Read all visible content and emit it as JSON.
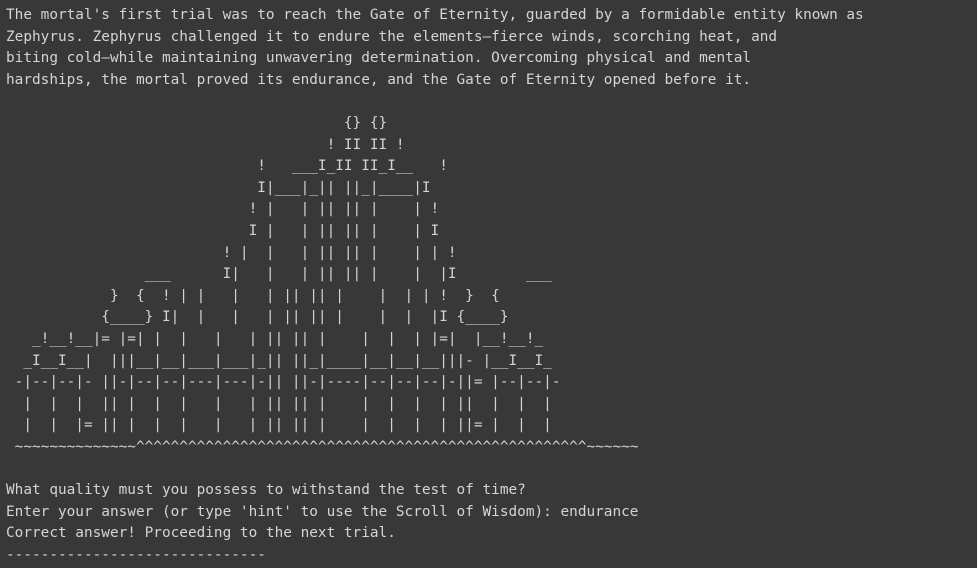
{
  "story": {
    "lines": [
      "The mortal's first trial was to reach the Gate of Eternity, guarded by a formidable entity known as",
      "Zephyrus. Zephyrus challenged it to endure the elements—fierce winds, scorching heat, and",
      "biting cold—while maintaining unwavering determination. Overcoming physical and mental",
      "hardships, the mortal proved its endurance, and the Gate of Eternity opened before it."
    ]
  },
  "art": {
    "lines": [
      "                                       {} {}",
      "                                     ! II II !",
      "                             !   ___I_II II_I__   !",
      "                             I|___|_|| ||_|____|I",
      "                            ! |   | || || |    | !",
      "                            I |   | || || |    | I",
      "                         ! |  |   | || || |    | | !",
      "                ___      I|   |   | || || |    |  |I        ___",
      "            }  {  ! | |   |   | || || |    |  | | !  }  {",
      "           {____} I|  |   |   | || || |    |  |  |I {____}",
      "   _!__!__|= |=| |  |   |   | || || |    |  |  | |=|  |__!__!_",
      "  _I__I__|  |||__|__|___|___|_|| ||_|____|__|__|__|||- |__I__I_",
      " -|--|--|- ||-|--|--|---|---|-|| ||-|----|--|--|--|-||= |--|--|-",
      "  |  |  |  || |  |  |   |   | || || |    |  |  |  | ||  |  |  |",
      "  |  |  |= || |  |  |   |   | || || |    |  |  |  | ||= |  |  |",
      " ~~~~~~~~~~~~~~^^^^^^^^^^^^^^^^^^^^^^^^^^^^^^^^^^^^^^^^^^^^^^^^^^^^~~~~~~"
    ]
  },
  "dialog": {
    "question": "What quality must you possess to withstand the test of time?",
    "prompt": "Enter your answer (or type 'hint' to use the Scroll of Wisdom): endurance",
    "result": "Correct answer! Proceeding to the next trial.",
    "separator": "------------------------------"
  }
}
